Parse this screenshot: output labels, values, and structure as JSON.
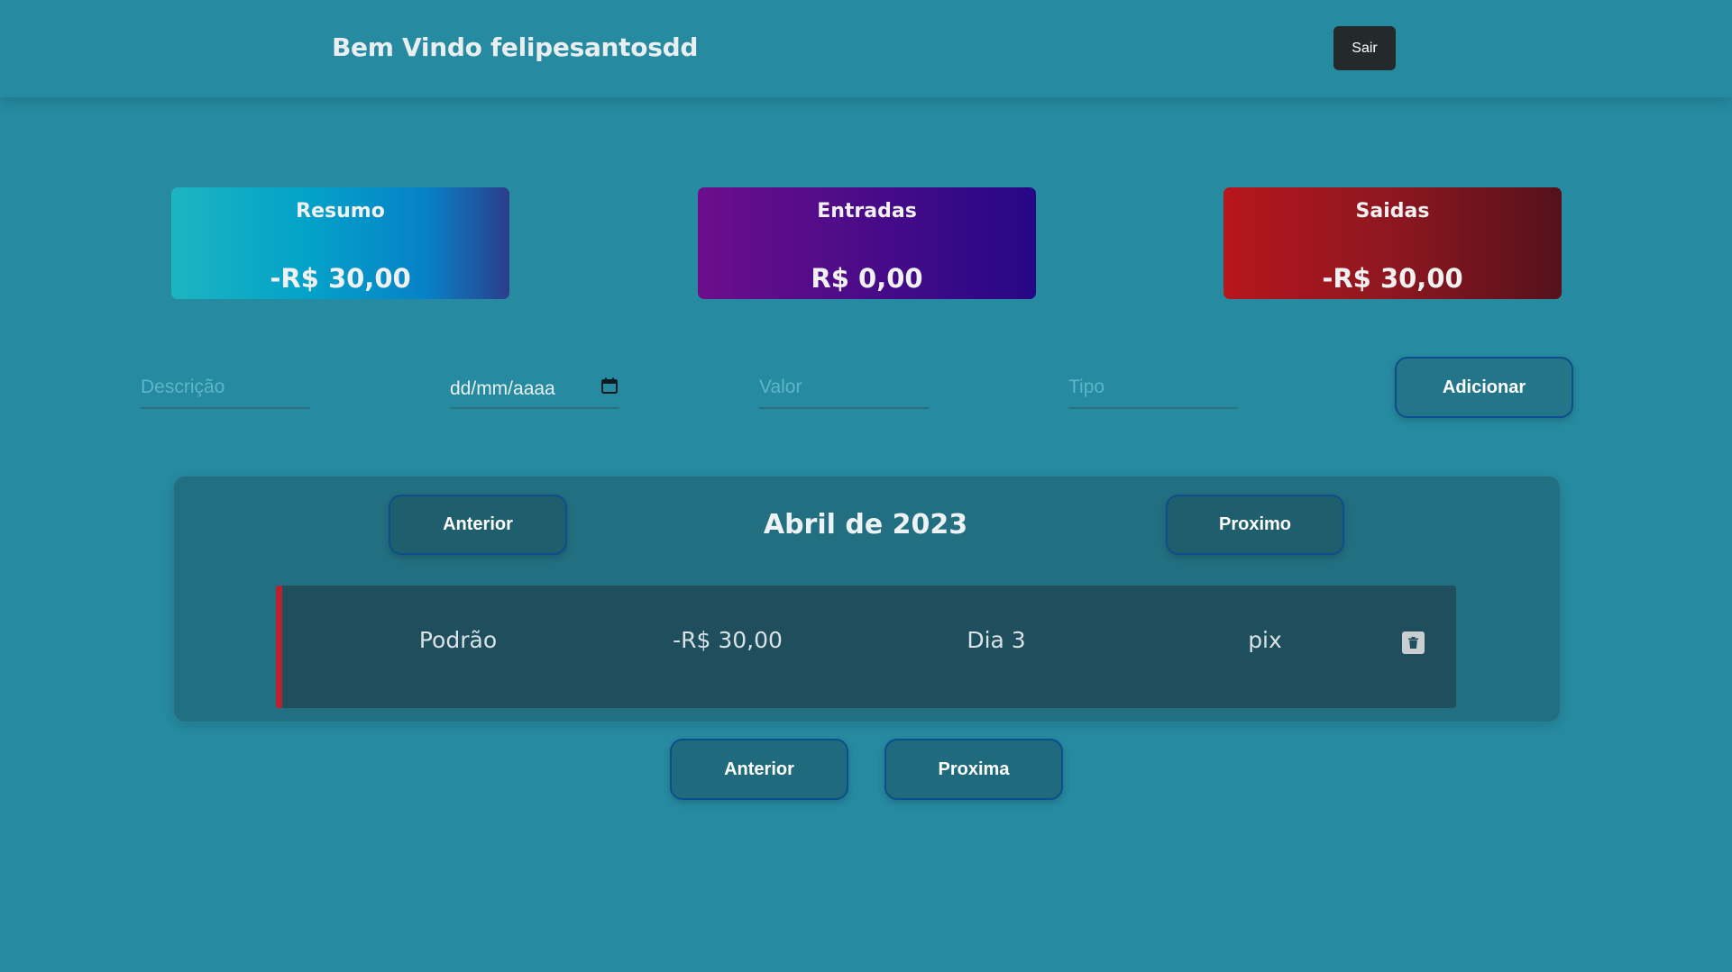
{
  "header": {
    "welcome": "Bem Vindo felipesantosdd",
    "logout_label": "Sair"
  },
  "summary": {
    "resumo": {
      "title": "Resumo",
      "value": "-R$ 30,00"
    },
    "entradas": {
      "title": "Entradas",
      "value": "R$ 0,00"
    },
    "saidas": {
      "title": "Saidas",
      "value": "-R$ 30,00"
    }
  },
  "form": {
    "descricao_placeholder": "Descrição",
    "date_placeholder": "dd/mm/aaaa",
    "valor_placeholder": "Valor",
    "tipo_placeholder": "Tipo",
    "add_label": "Adicionar"
  },
  "month_nav": {
    "prev_label": "Anterior",
    "title": "Abril de 2023",
    "next_label": "Proximo"
  },
  "transactions": [
    {
      "descricao": "Podrão",
      "valor": "-R$ 30,00",
      "dia": "Dia 3",
      "tipo": "pix"
    }
  ],
  "pagination": {
    "prev_label": "Anterior",
    "next_label": "Proxima"
  },
  "colors": {
    "background": "#268aa0",
    "expense_accent": "#c0202e"
  }
}
